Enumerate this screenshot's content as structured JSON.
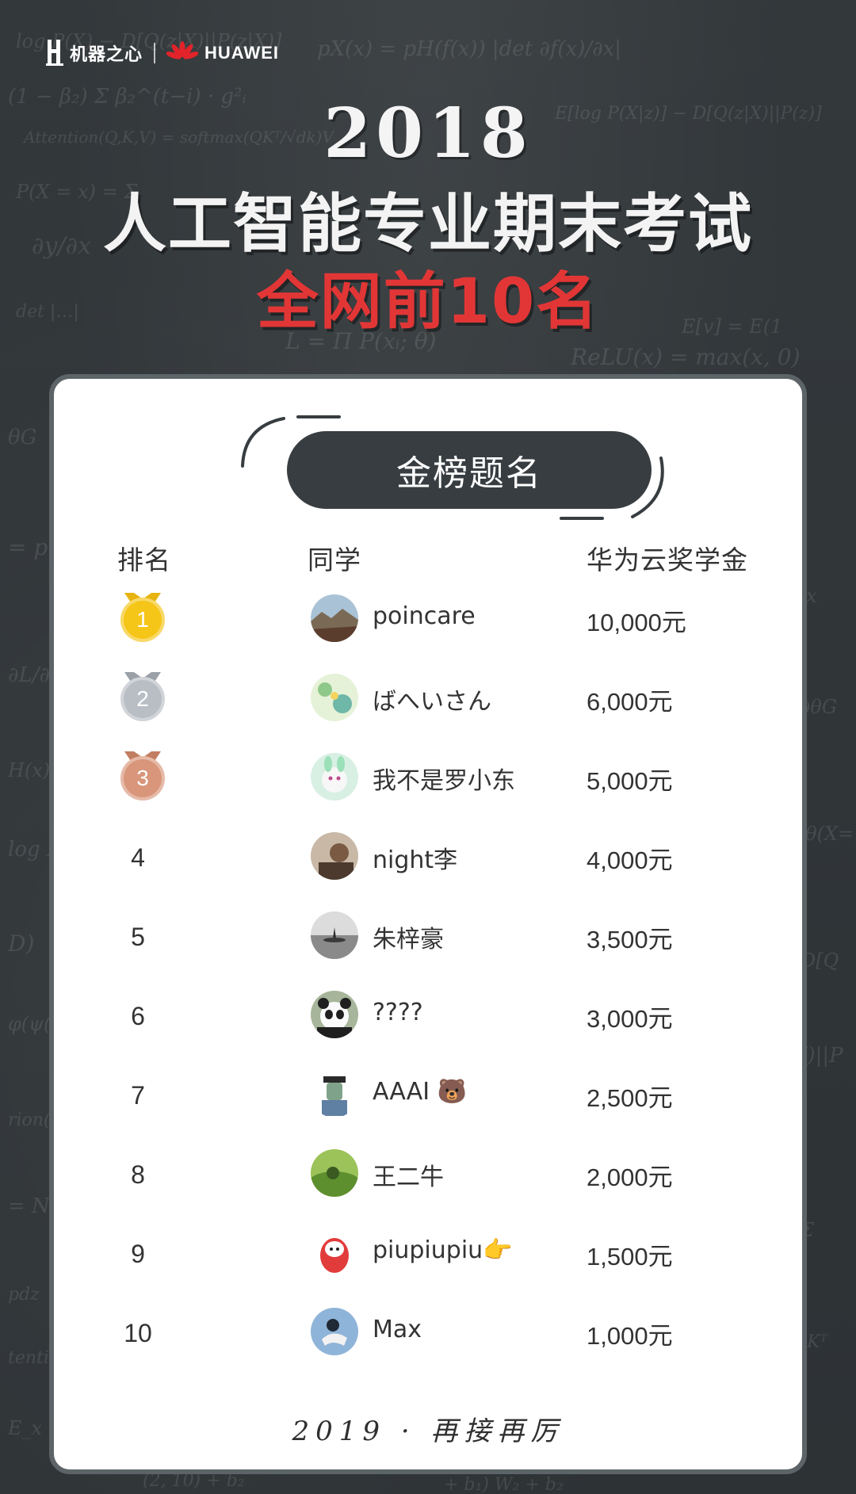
{
  "header": {
    "brand_jqzx": "机器之心",
    "brand_huawei": "HUAWEI"
  },
  "title": {
    "year": "2018",
    "main": "人工智能专业期末考试",
    "sub": "全网前10名"
  },
  "card": {
    "badge": "金榜题名",
    "columns": {
      "rank": "排名",
      "student": "同学",
      "prize": "华为云奖学金"
    },
    "rows": [
      {
        "rank": "1",
        "name": "poincare",
        "prize": "10,000元",
        "medal": "gold"
      },
      {
        "rank": "2",
        "name": "ばへいさん",
        "prize": "6,000元",
        "medal": "silver"
      },
      {
        "rank": "3",
        "name": "我不是罗小东",
        "prize": "5,000元",
        "medal": "bronze"
      },
      {
        "rank": "4",
        "name": "night李",
        "prize": "4,000元"
      },
      {
        "rank": "5",
        "name": "朱梓豪",
        "prize": "3,500元"
      },
      {
        "rank": "6",
        "name": "????",
        "prize": "3,000元"
      },
      {
        "rank": "7",
        "name": "AAAI 🐻",
        "prize": "2,500元"
      },
      {
        "rank": "8",
        "name": "王二牛",
        "prize": "2,000元"
      },
      {
        "rank": "9",
        "name": "piupiupiu👉",
        "prize": "1,500元"
      },
      {
        "rank": "10",
        "name": "Max",
        "prize": "1,000元"
      }
    ],
    "footer": "2019 · 再接再厉"
  },
  "colors": {
    "board": "#2f3336",
    "title_red": "#e23636",
    "badge_bg": "#373d41",
    "gold": "#f5c518",
    "silver": "#b9bec5",
    "bronze": "#d9967a"
  }
}
